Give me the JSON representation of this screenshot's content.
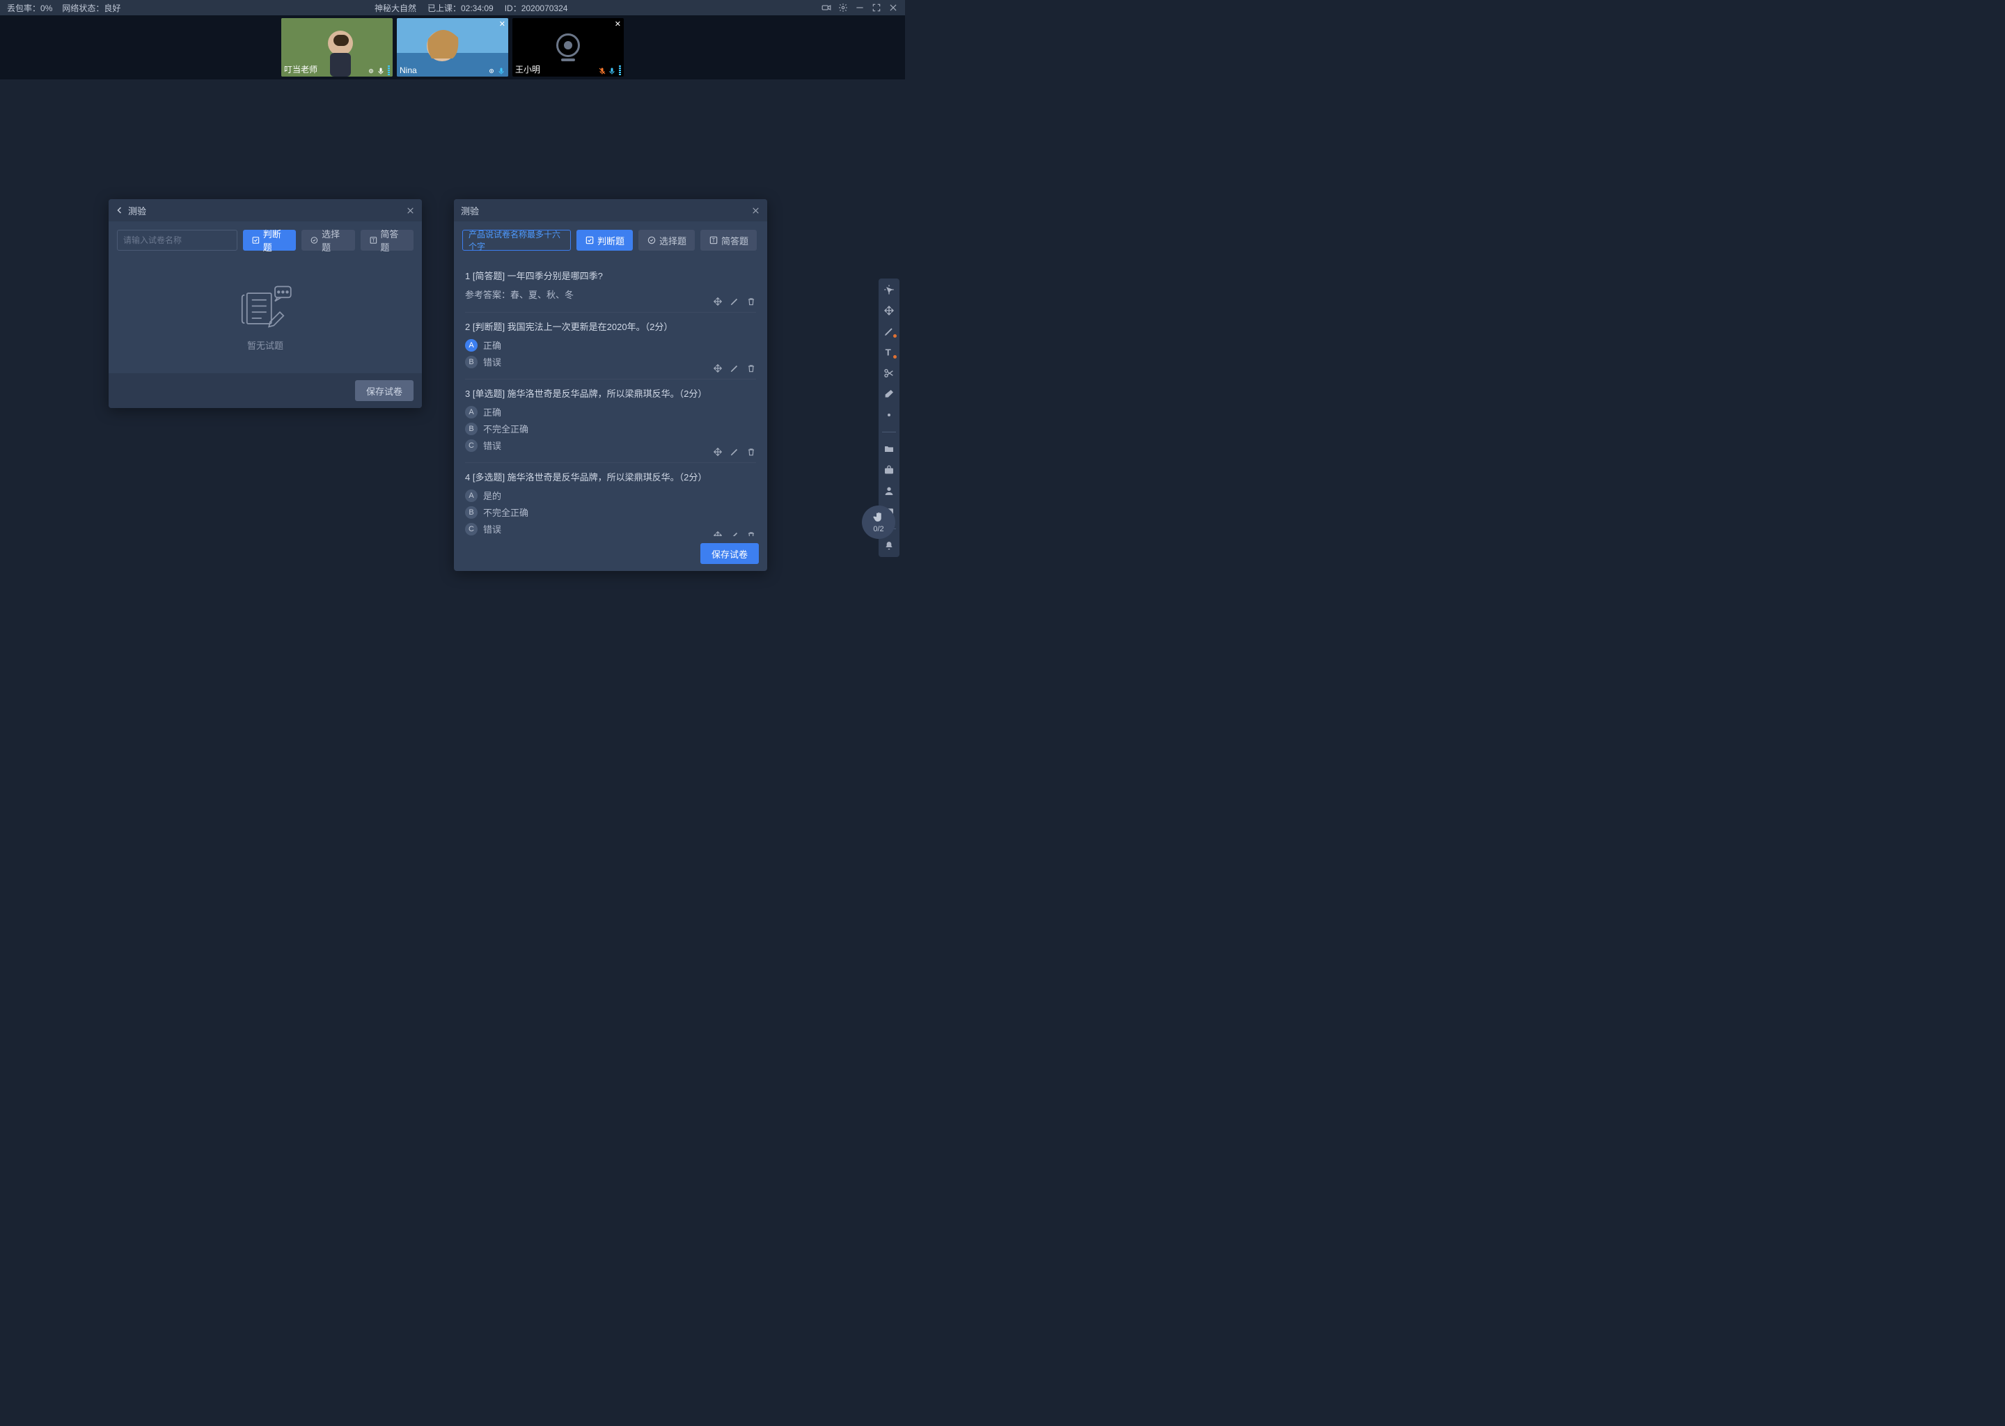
{
  "topbar": {
    "packet_loss_label": "丢包率：",
    "packet_loss_value": "0%",
    "network_label": "网络状态：",
    "network_value": "良好",
    "course_name": "神秘大自然",
    "elapsed_label": "已上课：",
    "elapsed_value": "02:34:09",
    "id_label": "ID：",
    "id_value": "2020070324"
  },
  "videos": [
    {
      "name": "叮当老师",
      "has_close": false,
      "camera_off": false,
      "mic_muted": false
    },
    {
      "name": "Nina",
      "has_close": true,
      "camera_off": false,
      "mic_muted": false
    },
    {
      "name": "王小明",
      "has_close": true,
      "camera_off": true,
      "mic_muted": true
    }
  ],
  "left_panel": {
    "title": "测验",
    "input_placeholder": "请输入试卷名称",
    "input_value": "",
    "empty_text": "暂无试题",
    "save_label": "保存试卷",
    "tool_buttons": [
      {
        "active": true,
        "label": "判断题"
      },
      {
        "active": false,
        "label": "选择题"
      },
      {
        "active": false,
        "label": "简答题"
      }
    ]
  },
  "right_panel": {
    "title": "测验",
    "input_value": "产品说试卷名称最多十六个字",
    "save_label": "保存试卷",
    "tool_buttons": [
      {
        "active": true,
        "label": "判断题"
      },
      {
        "active": false,
        "label": "选择题"
      },
      {
        "active": false,
        "label": "简答题"
      }
    ],
    "questions": [
      {
        "title": "1 [简答题] 一年四季分别是哪四季?",
        "answer_label": "参考答案：春、夏、秋、冬",
        "options": []
      },
      {
        "title": "2 [判断题] 我国宪法上一次更新是在2020年。（2分）",
        "options": [
          {
            "letter": "A",
            "text": "正确",
            "selected": true
          },
          {
            "letter": "B",
            "text": "错误",
            "selected": false
          }
        ]
      },
      {
        "title": "3 [单选题] 施华洛世奇是反华品牌，所以梁鼎琪反华。（2分）",
        "options": [
          {
            "letter": "A",
            "text": "正确",
            "selected": false
          },
          {
            "letter": "B",
            "text": "不完全正确",
            "selected": false
          },
          {
            "letter": "C",
            "text": "错误",
            "selected": false
          }
        ]
      },
      {
        "title": "4 [多选题] 施华洛世奇是反华品牌，所以梁鼎琪反华。（2分）",
        "options": [
          {
            "letter": "A",
            "text": "是的",
            "selected": false
          },
          {
            "letter": "B",
            "text": "不完全正确",
            "selected": false
          },
          {
            "letter": "C",
            "text": "错误",
            "selected": false
          }
        ]
      }
    ]
  },
  "hand": {
    "count": "0/2"
  }
}
